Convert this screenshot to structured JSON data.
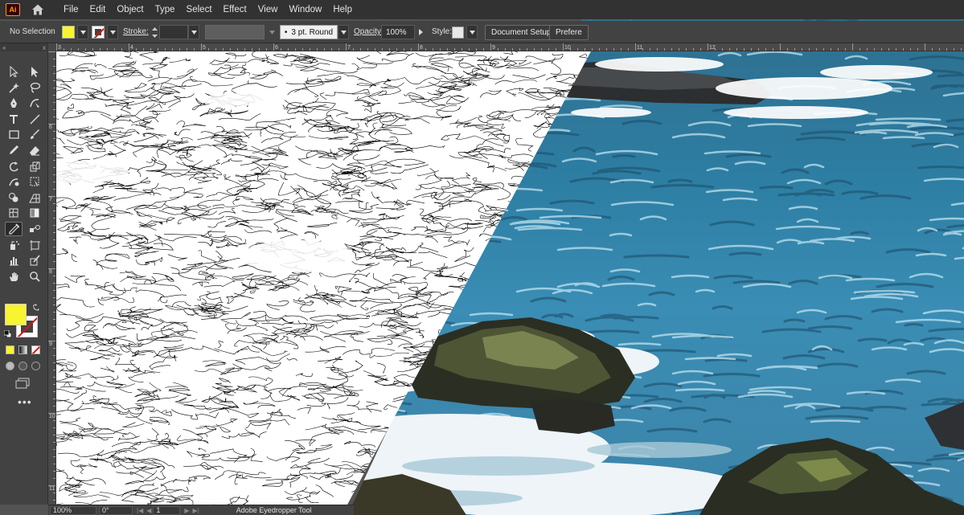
{
  "app": {
    "logo_text": "Ai"
  },
  "menu": [
    "File",
    "Edit",
    "Object",
    "Type",
    "Select",
    "Effect",
    "View",
    "Window",
    "Help"
  ],
  "control_bar": {
    "selection_label": "No Selection",
    "fill_color": "#f8f430",
    "stroke_label": "Stroke:",
    "brush_value": "3 pt. Round",
    "brush_dot": "•",
    "opacity_label": "Opacity:",
    "opacity_value": "100%",
    "style_label": "Style:",
    "document_setup_label": "Document Setup",
    "preferences_label": "Prefere"
  },
  "tools_panel": {
    "collapse_left": "«",
    "collapse_right": "x",
    "more_label": "•••",
    "active_tool": "eyedropper-icon",
    "tools": [
      "selection-icon",
      "direct-selection-icon",
      "magic-wand-icon",
      "lasso-icon",
      "pen-icon",
      "curvature-icon",
      "type-icon",
      "line-segment-icon",
      "rectangle-icon",
      "paintbrush-icon",
      "pencil-icon",
      "eraser-icon",
      "rotate-icon",
      "scale-icon",
      "warp-icon",
      "free-transform-icon",
      "shape-builder-icon",
      "perspective-grid-icon",
      "mesh-icon",
      "gradient-icon",
      "eyedropper-icon",
      "blend-icon",
      "symbol-sprayer-icon",
      "artboard-icon",
      "column-graph-icon",
      "slice-icon",
      "hand-icon",
      "zoom-icon"
    ]
  },
  "rulers": {
    "horizontal_labels": [
      "3",
      "4",
      "5",
      "6",
      "7",
      "8",
      "9",
      "10",
      "11",
      "12"
    ],
    "vertical_labels": [
      "6",
      "7",
      "8",
      "9",
      "10",
      "11"
    ]
  },
  "status_bar": {
    "zoom": "100%",
    "rotation": "0°",
    "artboard": "1",
    "tool_name": "Adobe Eyedropper Tool"
  },
  "colors": {
    "menu_bg": "#323232",
    "panel_bg": "#424242",
    "accent_fill": "#f8f430",
    "stroke_none": "#dd1111"
  }
}
